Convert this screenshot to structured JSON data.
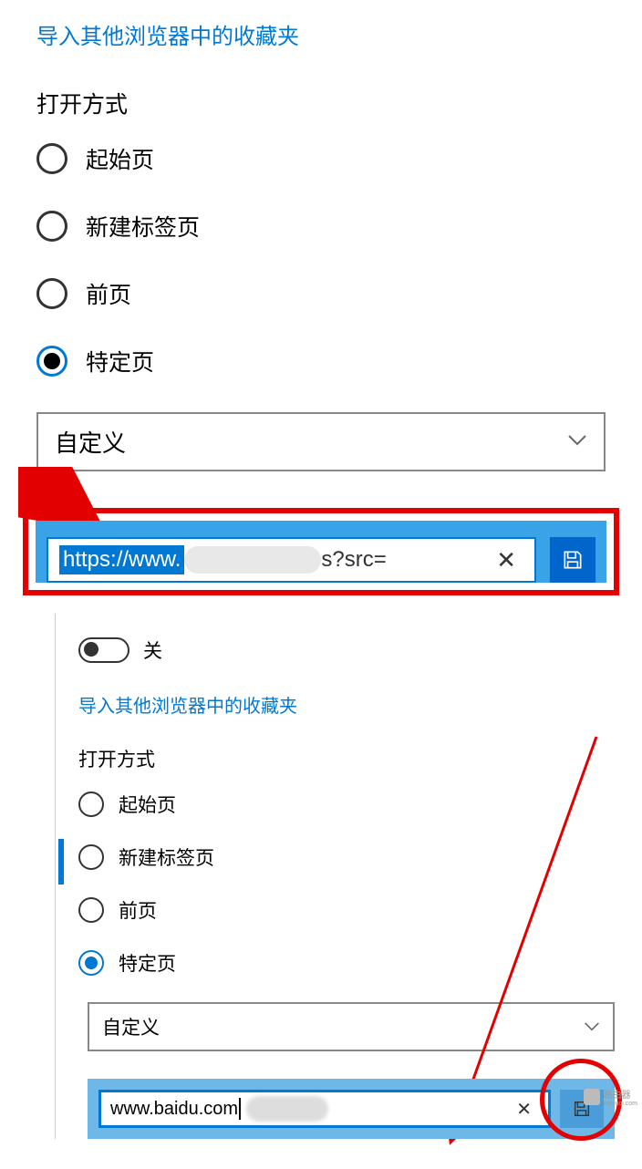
{
  "panel1": {
    "import_link": "导入其他浏览器中的收藏夹",
    "open_with_title": "打开方式",
    "radios": {
      "start_page": "起始页",
      "new_tab": "新建标签页",
      "previous": "前页",
      "specific": "特定页"
    },
    "dropdown_value": "自定义",
    "url_part1": "https://www.",
    "url_part2": "s?src=",
    "close": "✕"
  },
  "panel2": {
    "toggle_label": "关",
    "import_link": "导入其他浏览器中的收藏夹",
    "open_with_title": "打开方式",
    "radios": {
      "start_page": "起始页",
      "new_tab": "新建标签页",
      "previous": "前页",
      "specific": "特定页"
    },
    "dropdown_value": "自定义",
    "url_value": "www.baidu.com",
    "close": "✕"
  },
  "watermark": {
    "text": "路由器",
    "sub": "luyouqi.com"
  }
}
